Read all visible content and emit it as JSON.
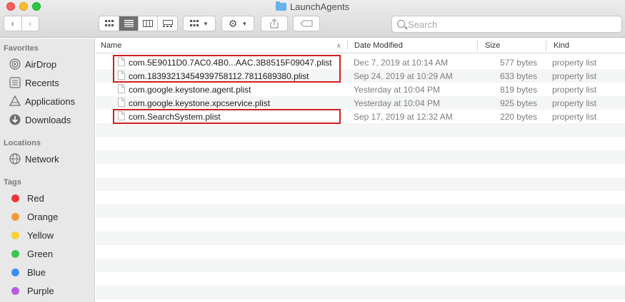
{
  "window": {
    "title": "LaunchAgents"
  },
  "toolbar": {
    "back_icon": "chevron-left-icon",
    "forward_icon": "chevron-right-icon",
    "views": [
      "icon-view",
      "list-view",
      "column-view",
      "gallery-view"
    ],
    "active_view": "list-view",
    "group_icon": "group-by-icon",
    "action_icon": "gear-icon",
    "share_icon": "share-icon",
    "tag_icon": "tag-icon",
    "search_placeholder": "Search"
  },
  "sidebar": {
    "favorites_label": "Favorites",
    "favorites": [
      {
        "label": "AirDrop",
        "icon": "airdrop-icon"
      },
      {
        "label": "Recents",
        "icon": "recents-icon"
      },
      {
        "label": "Applications",
        "icon": "applications-icon"
      },
      {
        "label": "Downloads",
        "icon": "downloads-icon"
      }
    ],
    "locations_label": "Locations",
    "locations": [
      {
        "label": "Network",
        "icon": "network-icon"
      }
    ],
    "tags_label": "Tags",
    "tags": [
      {
        "label": "Red",
        "color": "#f0353a"
      },
      {
        "label": "Orange",
        "color": "#f49b36"
      },
      {
        "label": "Yellow",
        "color": "#f6d133"
      },
      {
        "label": "Green",
        "color": "#3bc655"
      },
      {
        "label": "Blue",
        "color": "#3d8ef7"
      },
      {
        "label": "Purple",
        "color": "#b75adf"
      }
    ]
  },
  "list": {
    "columns": {
      "name": "Name",
      "date": "Date Modified",
      "size": "Size",
      "kind": "Kind"
    },
    "rows": [
      {
        "name": "com.5E9011D0.7AC0.4B0...AAC.3B8515F09047.plist",
        "date": "Dec 7, 2019 at 10:14 AM",
        "size": "577 bytes",
        "kind": "property list"
      },
      {
        "name": "com.18393213454939758112.7811689380.plist",
        "date": "Sep 24, 2019 at 10:29 AM",
        "size": "633 bytes",
        "kind": "property list"
      },
      {
        "name": "com.google.keystone.agent.plist",
        "date": "Yesterday at 10:04 PM",
        "size": "819 bytes",
        "kind": "property list"
      },
      {
        "name": "com.google.keystone.xpcservice.plist",
        "date": "Yesterday at 10:04 PM",
        "size": "925 bytes",
        "kind": "property list"
      },
      {
        "name": "com.SearchSystem.plist",
        "date": "Sep 17, 2019 at 12:32 AM",
        "size": "220 bytes",
        "kind": "property list"
      }
    ],
    "highlight_color": "#d21f1f"
  }
}
